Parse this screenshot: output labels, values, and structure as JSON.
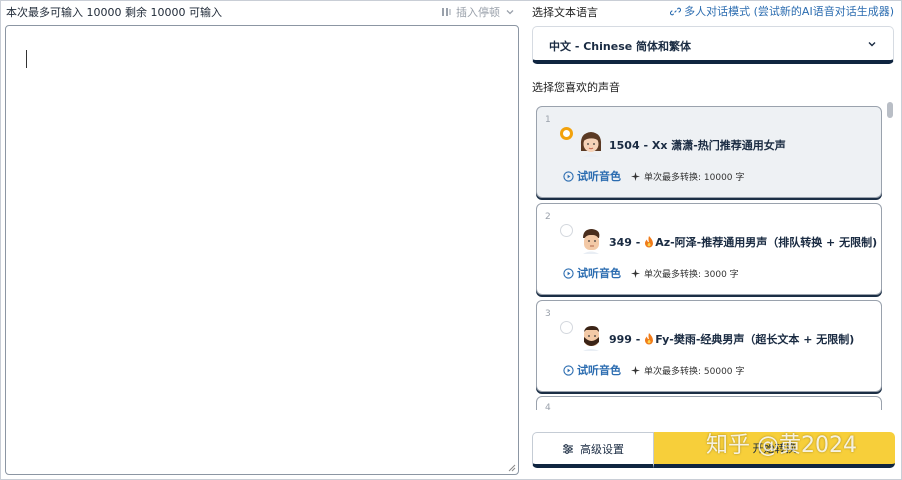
{
  "editor": {
    "limit_text": "本次最多可输入 10000 剩余 10000 可输入",
    "insert_pause_label": "插入停顿",
    "content": ""
  },
  "language": {
    "section_label": "选择文本语言",
    "multi_link": "多人对话模式 (尝试新的AI语音对话生成器)",
    "selected": "中文 - Chinese 简体和繁体"
  },
  "voices": {
    "section_label": "选择您喜欢的声音",
    "items": [
      {
        "index": "1",
        "name_prefix": "1504 - Xx 潇潇-热门推荐通用女声",
        "flame": false,
        "name_suffix": "",
        "preview_label": "试听音色",
        "max_label": "单次最多转换: 10000 字",
        "selected": true
      },
      {
        "index": "2",
        "name_prefix": "349 - ",
        "flame": true,
        "name_suffix": "Az-阿泽-推荐通用男声（排队转换 + 无限制)",
        "preview_label": "试听音色",
        "max_label": "单次最多转换: 3000 字",
        "selected": false
      },
      {
        "index": "3",
        "name_prefix": "999 - ",
        "flame": true,
        "name_suffix": "Fy-樊雨-经典男声（超长文本 + 无限制)",
        "preview_label": "试听音色",
        "max_label": "单次最多转换: 50000 字",
        "selected": false
      },
      {
        "index": "4"
      }
    ]
  },
  "actions": {
    "advanced_label": "高级设置",
    "start_label": "开始转换"
  },
  "watermark": "知乎 @黄2024",
  "colors": {
    "accent_yellow": "#f7cf3a",
    "link_blue": "#2b6cb0",
    "navy": "#0f2540",
    "radio_orange": "#f2a20c"
  },
  "icons": {
    "insert": "pause-insert-icon",
    "link": "link-icon",
    "chevron": "chevron-down-icon",
    "preview": "play-circle-icon",
    "sparkle": "sparkle-icon",
    "settings": "sliders-icon",
    "flame": "flame-icon"
  }
}
